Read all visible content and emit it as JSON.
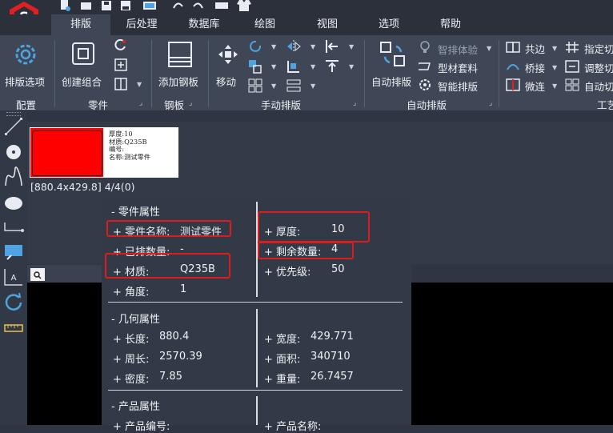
{
  "tabs": [
    {
      "label": "排版",
      "active": true
    },
    {
      "label": "后处理",
      "active": false
    },
    {
      "label": "数据库",
      "active": false
    },
    {
      "label": "绘图",
      "active": false
    },
    {
      "label": "视图",
      "active": false
    },
    {
      "label": "选项",
      "active": false
    },
    {
      "label": "帮助",
      "active": false
    }
  ],
  "ribbon": {
    "config": {
      "button": "排版选项",
      "group": "配置"
    },
    "part": {
      "button": "创建组合",
      "group": "零件"
    },
    "plate": {
      "button": "添加钢板",
      "group": "钢板"
    },
    "manual": {
      "button": "移动",
      "group": "手动排版"
    },
    "auto": {
      "button": "自动排版",
      "group": "自动排版",
      "items": [
        "智排体验",
        "型材套料",
        "智能排版"
      ]
    },
    "process": {
      "group": "工艺",
      "items": [
        "共边",
        "桥接",
        "微连",
        "指定切",
        "调整切",
        "自动切"
      ]
    }
  },
  "part_preview": {
    "thumb_lines": [
      "厚度:10",
      "材质:Q235B",
      "编号:",
      "名称:测试零件"
    ],
    "dims": "[880.4x429.8] 4/4(0)"
  },
  "props": {
    "part_header": "- 零件属性",
    "part_name_label": "+ 零件名称:",
    "part_name_value": "测试零件",
    "placed_label": "+ 已排数量:",
    "placed_value": "-",
    "material_label": "+ 材质:",
    "material_value": "Q235B",
    "angle_label": "+ 角度:",
    "angle_value": "1",
    "thickness_label": "+ 厚度:",
    "thickness_value": "10",
    "remaining_label": "+ 剩余数量:",
    "remaining_value": "4",
    "priority_label": "+ 优先级:",
    "priority_value": "50",
    "geom_header": "- 几何属性",
    "length_label": "+ 长度:",
    "length_value": "880.4",
    "perimeter_label": "+ 周长:",
    "perimeter_value": "2570.39",
    "density_label": "+ 密度:",
    "density_value": "7.85",
    "width_label": "+ 宽度:",
    "width_value": "429.771",
    "area_label": "+ 面积:",
    "area_value": "340710",
    "weight_label": "+ 重量:",
    "weight_value": "26.7457",
    "product_header": "- 产品属性",
    "product_code_label": "+ 产品编号:",
    "product_name_label": "+ 产品名称:"
  },
  "colors": {
    "highlight": "#e01b1b",
    "ribbon": "#3f4756",
    "canvas": "#000000",
    "accent_blue": "#4fa3e0",
    "logo_red": "#e02020"
  },
  "icons": [
    "app-logo-icon",
    "new-file-icon",
    "open-icon",
    "save-icon",
    "print-icon",
    "undo-icon",
    "redo-icon",
    "shirt-icon",
    "gear-icon",
    "group-icon",
    "plate-icon",
    "move-icon",
    "rotate-icon",
    "mirror-icon",
    "auto-nest-icon",
    "bulb-icon",
    "profile-icon",
    "smart-gear-icon",
    "line-tool-icon",
    "circle-tool-icon",
    "spline-tool-icon",
    "ellipse-tool-icon",
    "path-tool-icon",
    "select-box-icon",
    "text-tool-icon",
    "refresh-icon",
    "measure-icon",
    "document-icon"
  ]
}
